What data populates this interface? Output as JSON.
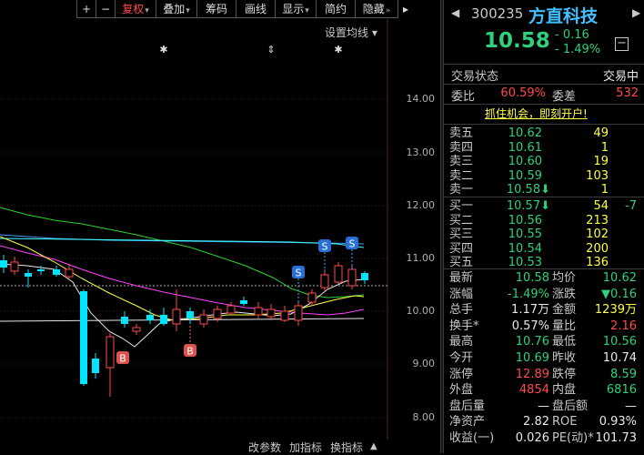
{
  "toolbar": {
    "plus": "+",
    "minus": "−",
    "items": [
      {
        "label": "复权",
        "caret": "▾"
      },
      {
        "label": "叠加",
        "caret": "▾"
      },
      {
        "label": "筹码",
        "caret": ""
      },
      {
        "label": "画线",
        "caret": ""
      },
      {
        "label": "显示",
        "caret": "▾"
      },
      {
        "label": "简约",
        "caret": ""
      },
      {
        "label": "隐藏",
        "caret": "»"
      }
    ],
    "hide_arrow": "▸"
  },
  "chart": {
    "ma_setting": "设置均线 ▾",
    "y_ticks": [
      "14.00",
      "13.00",
      "12.00",
      "11.00",
      "10.00",
      "9.00",
      "8.00"
    ],
    "markers": {
      "s": "S",
      "b": "B"
    },
    "event_marks": [
      "✱",
      "⇕",
      "✱"
    ]
  },
  "bottom_bar": {
    "params": "改参数",
    "add_indicator": "加指标",
    "change_indicator": "换指标",
    "up": "▲"
  },
  "quote": {
    "code": "300235",
    "name": "方直科技",
    "nav_prev": "◀",
    "nav_next": "▶",
    "price": "10.58",
    "change": "- 0.16",
    "change_pct": "- 1.49%",
    "collapse": "−",
    "status_label": "交易状态",
    "status_value": "交易中",
    "weibi_label": "委比",
    "weibi_value": "60.59%",
    "weicha_label": "委差",
    "weicha_value": "532",
    "ad": "抓住机会，即刻开户!",
    "asks": [
      {
        "name": "卖五",
        "price": "10.62",
        "vol": "49",
        "delta": ""
      },
      {
        "name": "卖四",
        "price": "10.61",
        "vol": "1",
        "delta": ""
      },
      {
        "name": "卖三",
        "price": "10.60",
        "vol": "19",
        "delta": ""
      },
      {
        "name": "卖二",
        "price": "10.59",
        "vol": "103",
        "delta": ""
      },
      {
        "name": "卖一",
        "price": "10.58",
        "arrow": "⬇",
        "vol": "1",
        "delta": ""
      }
    ],
    "bids": [
      {
        "name": "买一",
        "price": "10.57",
        "arrow": "⬇",
        "vol": "54",
        "delta": "-7"
      },
      {
        "name": "买二",
        "price": "10.56",
        "vol": "213",
        "delta": ""
      },
      {
        "name": "买三",
        "price": "10.55",
        "vol": "102",
        "delta": ""
      },
      {
        "name": "买四",
        "price": "10.54",
        "vol": "200",
        "delta": ""
      },
      {
        "name": "买五",
        "price": "10.53",
        "vol": "136",
        "delta": ""
      }
    ],
    "stats": [
      {
        "l1": "最新",
        "v1": "10.58",
        "c1": "green",
        "l2": "均价",
        "v2": "10.62",
        "c2": "green"
      },
      {
        "l1": "涨幅",
        "v1": "-1.49%",
        "c1": "green",
        "l2": "涨跌",
        "v2": "▼0.16",
        "c2": "green"
      },
      {
        "l1": "总手",
        "v1": "1.17万",
        "c1": "white",
        "l2": "金额",
        "v2": "1239万",
        "c2": "yellow"
      },
      {
        "l1": "换手*",
        "v1": "0.57%",
        "c1": "white",
        "l2": "量比",
        "v2": "2.16",
        "c2": "red"
      },
      {
        "l1": "最高",
        "v1": "10.76",
        "c1": "green",
        "l2": "最低",
        "v2": "10.56",
        "c2": "green"
      },
      {
        "l1": "今开",
        "v1": "10.69",
        "c1": "green",
        "l2": "昨收",
        "v2": "10.74",
        "c2": "white"
      },
      {
        "l1": "涨停",
        "v1": "12.89",
        "c1": "red",
        "l2": "跌停",
        "v2": "8.59",
        "c2": "green"
      },
      {
        "l1": "外盘",
        "v1": "4854",
        "c1": "red",
        "l2": "内盘",
        "v2": "6816",
        "c2": "green"
      },
      {
        "l1": "盘后量",
        "v1": "—",
        "c1": "white",
        "l2": "盘后额",
        "v2": "—",
        "c2": "white"
      },
      {
        "l1": "净资产",
        "v1": "2.82",
        "c1": "white",
        "l2": "ROE",
        "v2": "0.93%",
        "c2": "white"
      },
      {
        "l1": "收益(一)",
        "v1": "0.026",
        "c1": "white",
        "l2": "PE(动)*",
        "v2": "101.73",
        "c2": "white"
      }
    ]
  },
  "colors": {
    "up": "#ff4a4a",
    "down": "#2fd07a",
    "candle_down": "#00e5ff",
    "ma5": "#e8e8e8",
    "ma10": "#ffff40",
    "ma20": "#ff40ff",
    "ma60": "#30d030"
  }
}
